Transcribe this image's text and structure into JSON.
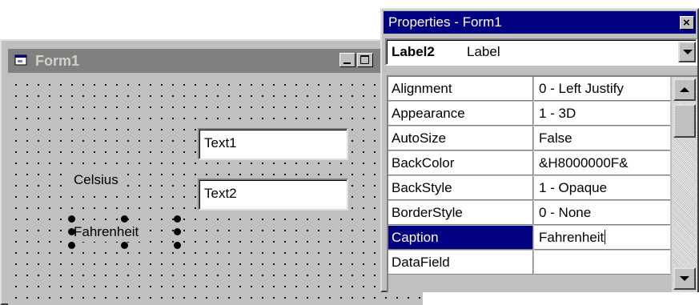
{
  "form_window": {
    "title": "Form1",
    "labels": {
      "celsius": "Celsius",
      "fahrenheit": "Fahrenheit"
    },
    "textboxes": {
      "text1": "Text1",
      "text2": "Text2"
    },
    "selected_control": "Fahrenheit"
  },
  "properties_window": {
    "title": "Properties - Form1",
    "close_glyph": "×",
    "object_selector": {
      "name": "Label2",
      "type": "Label"
    },
    "properties": [
      {
        "name": "Alignment",
        "value": "0 - Left Justify"
      },
      {
        "name": "Appearance",
        "value": "1 - 3D"
      },
      {
        "name": "AutoSize",
        "value": "False"
      },
      {
        "name": "BackColor",
        "value": "&H8000000F&"
      },
      {
        "name": "BackStyle",
        "value": "1 - Opaque"
      },
      {
        "name": "BorderStyle",
        "value": "0 - None"
      },
      {
        "name": "Caption",
        "value": "Fahrenheit"
      },
      {
        "name": "DataField",
        "value": ""
      }
    ],
    "selected_property": "Caption"
  },
  "colors": {
    "active_title": "#000080",
    "inactive_title": "#808080",
    "face": "#c0c0c0"
  }
}
